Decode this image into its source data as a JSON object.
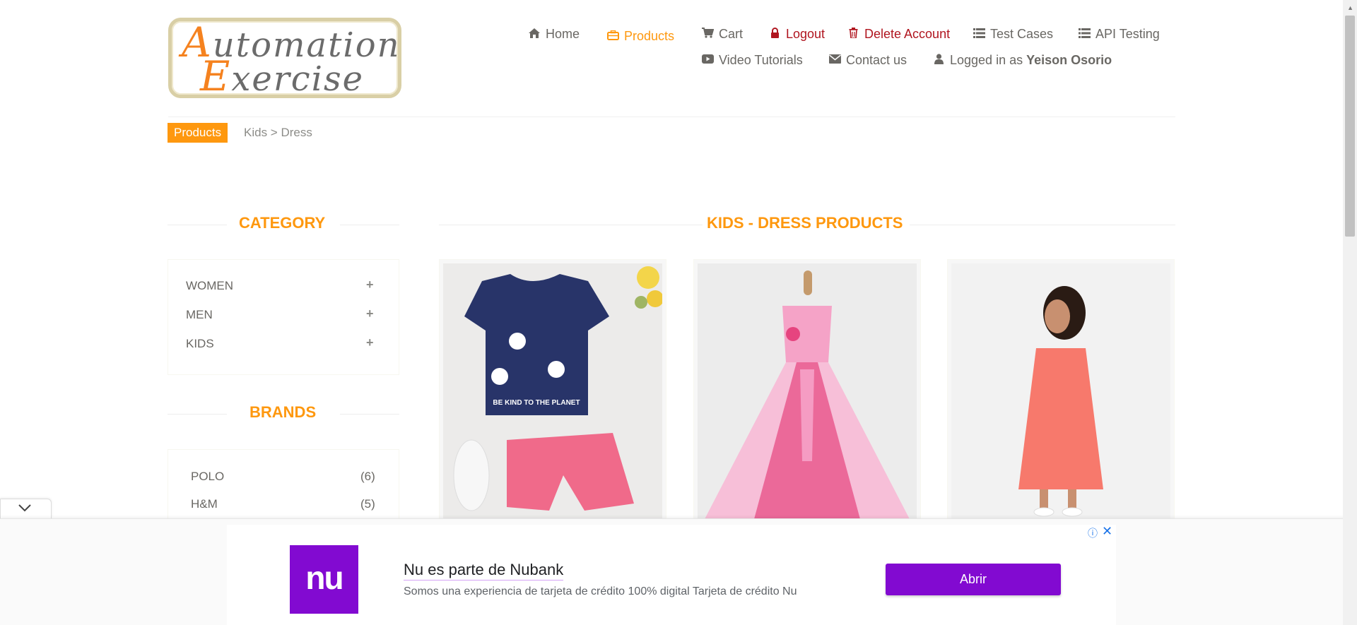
{
  "logo": {
    "line1_cap": "A",
    "line1_rest": "utomation",
    "line2_cap": "E",
    "line2_rest": "xercise"
  },
  "nav": {
    "home": "Home",
    "products": "Products",
    "cart": "Cart",
    "logout": "Logout",
    "delete_account": "Delete Account",
    "test_cases": "Test Cases",
    "api_testing": "API Testing",
    "video_tutorials": "Video Tutorials",
    "contact_us": "Contact us",
    "logged_in_prefix": "Logged in as",
    "username": "Yeison Osorio"
  },
  "breadcrumb": {
    "active": "Products",
    "path": "Kids > Dress"
  },
  "sidebar": {
    "category_title": "CATEGORY",
    "categories": [
      {
        "label": "WOMEN",
        "toggle": "+"
      },
      {
        "label": "MEN",
        "toggle": "+"
      },
      {
        "label": "KIDS",
        "toggle": "+"
      }
    ],
    "brands_title": "BRANDS",
    "brands": [
      {
        "label": "POLO",
        "count": "(6)"
      },
      {
        "label": "H&M",
        "count": "(5)"
      }
    ]
  },
  "main": {
    "title": "KIDS - DRESS PRODUCTS",
    "products": [
      {
        "image": "navy-top-pink-shorts"
      },
      {
        "image": "pink-tutu-dress"
      },
      {
        "image": "coral-girl-dress"
      }
    ]
  },
  "ad": {
    "logo": "nu",
    "title": "Nu es parte de Nubank",
    "description": "Somos una experiencia de tarjeta de crédito 100% digital Tarjeta de crédito Nu",
    "button": "Abrir",
    "info": "ⓘ",
    "close": "✕",
    "collapse": "⌄"
  },
  "colors": {
    "accent": "#fe980f",
    "danger": "#b0151f",
    "ad_brand": "#820ad1"
  }
}
